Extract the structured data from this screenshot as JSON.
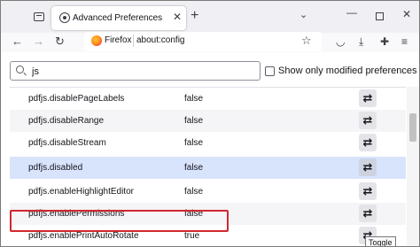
{
  "tab": {
    "title": "Advanced Preferences",
    "close_glyph": "✕"
  },
  "tabstrip": {
    "new_tab_glyph": "+",
    "list_glyph": "⌄",
    "min_glyph": "—",
    "close_glyph": "✕"
  },
  "nav": {
    "back_glyph": "←",
    "forward_glyph": "→",
    "reload_glyph": "↻",
    "identity_label": "Firefox",
    "url": "about:config",
    "star_glyph": "☆"
  },
  "toolbar_icons": [
    {
      "name": "pocket-icon",
      "glyph": "◡"
    },
    {
      "name": "downloads-icon",
      "glyph": "⤓"
    },
    {
      "name": "extensions-icon",
      "glyph": "✚"
    },
    {
      "name": "menu-icon",
      "glyph": "≡"
    }
  ],
  "search": {
    "value": "js",
    "placeholder": ""
  },
  "filter": {
    "label": "Show only modified preferences",
    "checked": false
  },
  "rows": [
    {
      "name": "pdfjs.disablePageLabels",
      "value": "false",
      "toggle_glyph": "⇄"
    },
    {
      "name": "pdfjs.disableRange",
      "value": "false",
      "toggle_glyph": "⇄"
    },
    {
      "name": "pdfjs.disableStream",
      "value": "false",
      "toggle_glyph": "⇄"
    },
    {
      "name": "pdfjs.disabled",
      "value": "false",
      "toggle_glyph": "⇄"
    },
    {
      "name": "pdfjs.enableHighlightEditor",
      "value": "false",
      "toggle_glyph": "⇄"
    },
    {
      "name": "pdfjs.enablePermissions",
      "value": "false",
      "toggle_glyph": "⇄"
    },
    {
      "name": "pdfjs.enablePrintAutoRotate",
      "value": "true",
      "toggle_glyph": "⇄"
    }
  ],
  "tooltip": {
    "text": "Toggle"
  },
  "colors": {
    "selected_row": "#d8e3fc",
    "highlight_border": "#d2272e",
    "accent": "#0061e0"
  }
}
